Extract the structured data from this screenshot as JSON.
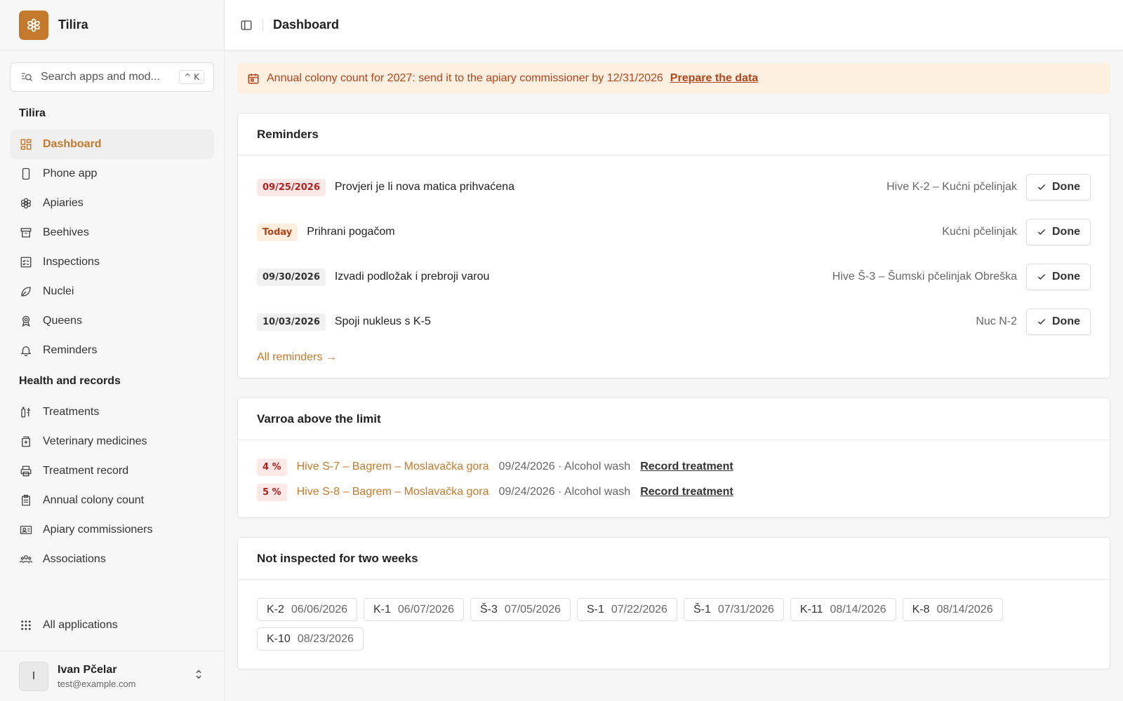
{
  "app": {
    "name": "Tilira"
  },
  "search": {
    "placeholder": "Search apps and mod...",
    "shortcut": "^ K"
  },
  "sidebar": {
    "group1_title": "Tilira",
    "group1": [
      {
        "label": "Dashboard",
        "icon": "dashboard-icon"
      },
      {
        "label": "Phone app",
        "icon": "phone-icon"
      },
      {
        "label": "Apiaries",
        "icon": "flower-icon"
      },
      {
        "label": "Beehives",
        "icon": "archive-icon"
      },
      {
        "label": "Inspections",
        "icon": "checklist-icon"
      },
      {
        "label": "Nuclei",
        "icon": "leaf-icon"
      },
      {
        "label": "Queens",
        "icon": "award-icon"
      },
      {
        "label": "Reminders",
        "icon": "bell-icon"
      }
    ],
    "group2_title": "Health and records",
    "group2": [
      {
        "label": "Treatments",
        "icon": "syringe-icon"
      },
      {
        "label": "Veterinary medicines",
        "icon": "medicine-icon"
      },
      {
        "label": "Treatment record",
        "icon": "printer-icon"
      },
      {
        "label": "Annual colony count",
        "icon": "clipboard-icon"
      },
      {
        "label": "Apiary commissioners",
        "icon": "id-card-icon"
      },
      {
        "label": "Associations",
        "icon": "users-icon"
      }
    ],
    "all_apps": "All applications"
  },
  "user": {
    "initial": "I",
    "name": "Ivan Pčelar",
    "email": "test@example.com"
  },
  "header": {
    "title": "Dashboard"
  },
  "banner": {
    "text": "Annual colony count for 2027: send it to the apiary commissioner by 12/31/2026",
    "link": "Prepare the data"
  },
  "reminders": {
    "title": "Reminders",
    "items": [
      {
        "date": "09/25/2026",
        "tone": "red",
        "text": "Provjeri je li nova matica prihvaćena",
        "location": "Hive K-2 – Kućni pčelinjak",
        "action": "Done"
      },
      {
        "date": "Today",
        "tone": "orange",
        "text": "Prihrani pogačom",
        "location": "Kućni pčelinjak",
        "action": "Done"
      },
      {
        "date": "09/30/2026",
        "tone": "gray",
        "text": "Izvadi podložak i prebroji varou",
        "location": "Hive Š-3 – Šumski pčelinjak Obreška",
        "action": "Done"
      },
      {
        "date": "10/03/2026",
        "tone": "gray",
        "text": "Spoji nukleus s K-5",
        "location": "Nuc N-2",
        "action": "Done"
      }
    ],
    "all_link": "All reminders →"
  },
  "varroa": {
    "title": "Varroa above the limit",
    "items": [
      {
        "percent": "4 %",
        "hive": "Hive S-7 – Bagrem – Moslavačka gora",
        "meta": "09/24/2026 · Alcohol wash",
        "action": "Record treatment"
      },
      {
        "percent": "5 %",
        "hive": "Hive S-8 – Bagrem – Moslavačka gora",
        "meta": "09/24/2026 · Alcohol wash",
        "action": "Record treatment"
      }
    ]
  },
  "not_inspected": {
    "title": "Not inspected for two weeks",
    "items": [
      {
        "hive": "K-2",
        "date": "06/06/2026"
      },
      {
        "hive": "K-1",
        "date": "06/07/2026"
      },
      {
        "hive": "Š-3",
        "date": "07/05/2026"
      },
      {
        "hive": "S-1",
        "date": "07/22/2026"
      },
      {
        "hive": "Š-1",
        "date": "07/31/2026"
      },
      {
        "hive": "K-11",
        "date": "08/14/2026"
      },
      {
        "hive": "K-8",
        "date": "08/14/2026"
      },
      {
        "hive": "K-10",
        "date": "08/23/2026"
      }
    ]
  },
  "colors": {
    "accent": "#c47a2c",
    "danger": "#b32020",
    "warning": "#b5441b"
  }
}
